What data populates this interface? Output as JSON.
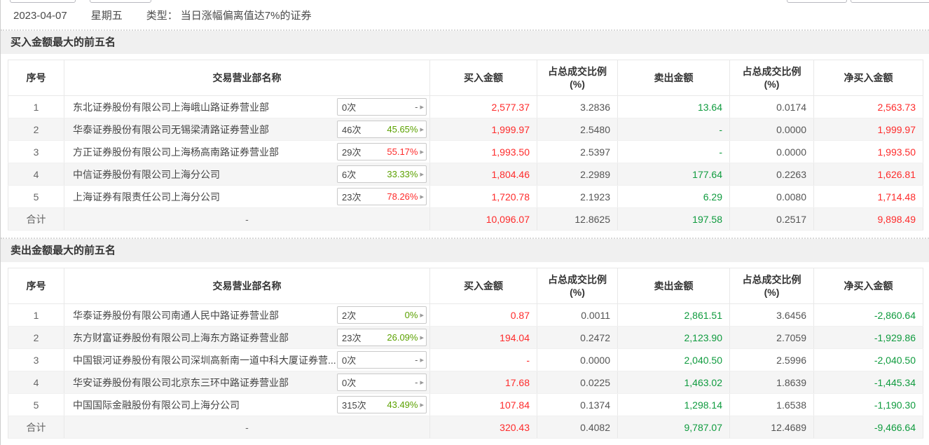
{
  "colors": {
    "red": "#fe2b2b",
    "green": "#0f9b3e",
    "badge_green": "#5ba100",
    "ratio_gray": "#555555"
  },
  "topbar": {
    "date": "2023-04-07",
    "weekday": "星期五",
    "type_label": "类型：",
    "type_value": "当日涨幅偏离值达7%的证券"
  },
  "columns": [
    "序号",
    "交易营业部名称",
    "买入金额",
    "占总成交比例\n(%)",
    "卖出金额",
    "占总成交比例\n(%)",
    "净买入金额"
  ],
  "sections": [
    {
      "title": "买入金额最大的前五名",
      "rows": [
        {
          "no": "1",
          "name": "东北证券股份有限公司上海峨山路证券营业部",
          "times": "0次",
          "rate": "-",
          "rate_color": "gray",
          "buy": "2,577.37",
          "buy_ratio": "3.2836",
          "sell": "13.64",
          "sell_ratio": "0.0174",
          "net": "2,563.73",
          "net_color": "red"
        },
        {
          "no": "2",
          "name": "华泰证券股份有限公司无锡梁清路证券营业部",
          "times": "46次",
          "rate": "45.65%",
          "rate_color": "lime",
          "buy": "1,999.97",
          "buy_ratio": "2.5480",
          "sell": "-",
          "sell_ratio": "0.0000",
          "net": "1,999.97",
          "net_color": "red"
        },
        {
          "no": "3",
          "name": "方正证券股份有限公司上海杨高南路证券营业部",
          "times": "29次",
          "rate": "55.17%",
          "rate_color": "red",
          "buy": "1,993.50",
          "buy_ratio": "2.5397",
          "sell": "-",
          "sell_ratio": "0.0000",
          "net": "1,993.50",
          "net_color": "red"
        },
        {
          "no": "4",
          "name": "中信证券股份有限公司上海分公司",
          "times": "6次",
          "rate": "33.33%",
          "rate_color": "lime",
          "buy": "1,804.46",
          "buy_ratio": "2.2989",
          "sell": "177.64",
          "sell_ratio": "0.2263",
          "net": "1,626.81",
          "net_color": "red"
        },
        {
          "no": "5",
          "name": "上海证券有限责任公司上海分公司",
          "times": "23次",
          "rate": "78.26%",
          "rate_color": "red",
          "buy": "1,720.78",
          "buy_ratio": "2.1923",
          "sell": "6.29",
          "sell_ratio": "0.0080",
          "net": "1,714.48",
          "net_color": "red"
        }
      ],
      "total": {
        "label": "合计",
        "name": "-",
        "buy": "10,096.07",
        "buy_ratio": "12.8625",
        "sell": "197.58",
        "sell_ratio": "0.2517",
        "net": "9,898.49",
        "net_color": "red"
      }
    },
    {
      "title": "卖出金额最大的前五名",
      "rows": [
        {
          "no": "1",
          "name": "华泰证券股份有限公司南通人民中路证券营业部",
          "times": "2次",
          "rate": "0%",
          "rate_color": "lime",
          "buy": "0.87",
          "buy_ratio": "0.0011",
          "sell": "2,861.51",
          "sell_ratio": "3.6456",
          "net": "-2,860.64",
          "net_color": "green"
        },
        {
          "no": "2",
          "name": "东方财富证券股份有限公司上海东方路证券营业部",
          "times": "23次",
          "rate": "26.09%",
          "rate_color": "lime",
          "buy": "194.04",
          "buy_ratio": "0.2472",
          "sell": "2,123.90",
          "sell_ratio": "2.7059",
          "net": "-1,929.86",
          "net_color": "green"
        },
        {
          "no": "3",
          "name": "中国银河证券股份有限公司深圳高新南一道中科大厦证券营...",
          "times": "0次",
          "rate": "-",
          "rate_color": "gray",
          "buy": "-",
          "buy_ratio": "0.0000",
          "sell": "2,040.50",
          "sell_ratio": "2.5996",
          "net": "-2,040.50",
          "net_color": "green"
        },
        {
          "no": "4",
          "name": "华安证券股份有限公司北京东三环中路证券营业部",
          "times": "0次",
          "rate": "-",
          "rate_color": "gray",
          "buy": "17.68",
          "buy_ratio": "0.0225",
          "sell": "1,463.02",
          "sell_ratio": "1.8639",
          "net": "-1,445.34",
          "net_color": "green"
        },
        {
          "no": "5",
          "name": "中国国际金融股份有限公司上海分公司",
          "times": "315次",
          "rate": "43.49%",
          "rate_color": "lime",
          "buy": "107.84",
          "buy_ratio": "0.1374",
          "sell": "1,298.14",
          "sell_ratio": "1.6538",
          "net": "-1,190.30",
          "net_color": "green"
        }
      ],
      "total": {
        "label": "合计",
        "name": "-",
        "buy": "320.43",
        "buy_ratio": "0.4082",
        "sell": "9,787.07",
        "sell_ratio": "12.4689",
        "net": "-9,466.64",
        "net_color": "green"
      }
    }
  ],
  "badge": {
    "arrow_icon": "▸"
  }
}
